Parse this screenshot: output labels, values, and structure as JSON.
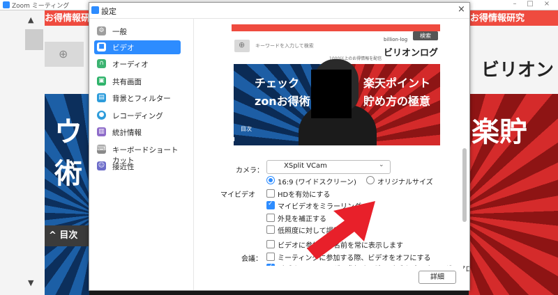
{
  "window": {
    "title": "Zoom ミーティング"
  },
  "background": {
    "banner_left": "お得情報研究",
    "banner_right": "お得情報研究",
    "text_right": "ビリオン",
    "jp_left": "ウ術",
    "jp_right": "楽貯",
    "tag_left": "^ 目次"
  },
  "dialog": {
    "title": "設定",
    "close": "×",
    "nav": [
      {
        "label": "一般",
        "icon": "gear-icon",
        "color": "#9e9e9e"
      },
      {
        "label": "ビデオ",
        "icon": "video-camera-icon",
        "color": "#2d8cff",
        "active": true
      },
      {
        "label": "オーディオ",
        "icon": "headphones-icon",
        "color": "#3cb371"
      },
      {
        "label": "共有画面",
        "icon": "share-screen-icon",
        "color": "#2fb36b"
      },
      {
        "label": "背景とフィルター",
        "icon": "background-icon",
        "color": "#2d9cdb"
      },
      {
        "label": "レコーディング",
        "icon": "record-icon",
        "color": "#2d9cdb"
      },
      {
        "label": "統計情報",
        "icon": "stats-icon",
        "color": "#8e6cc9"
      },
      {
        "label": "キーボードショートカット",
        "icon": "keyboard-icon",
        "color": "#8a8a8a"
      },
      {
        "label": "接近性",
        "icon": "accessibility-icon",
        "color": "#6c6cc9"
      }
    ],
    "preview": {
      "mirror_text": "キーワードを入力して検索",
      "logo_small": "billion-log",
      "logo_big": "ビリオンログ",
      "sub_text": "1000以上のお得情報を配信",
      "button": "検索",
      "jp1": "楽天ポイント",
      "jp2": "貯め方の極意",
      "jp3": "チェック",
      "jp4": "zonお得術",
      "tag": "目次"
    },
    "camera_label": "カメラ：",
    "camera_value": "XSplit VCam",
    "ratio_options": [
      {
        "label": "16:9 (ワイドスクリーン)",
        "selected": true
      },
      {
        "label": "オリジナルサイズ",
        "selected": false
      }
    ],
    "myvideo_label": "マイビデオ",
    "myvideo_options": [
      {
        "label": "HDを有効にする",
        "checked": false
      },
      {
        "label": "マイビデオをミラーリング",
        "checked": true
      },
      {
        "label": "外見を補正する",
        "checked": false
      },
      {
        "label": "低照度に対して調整",
        "checked": false
      }
    ],
    "meeting_label": "会議：",
    "meeting_options": [
      {
        "label": "ビデオに参加者の名前を常に表示します",
        "checked": false
      },
      {
        "label": "ミーティングに参加する際、ビデオをオフにする",
        "checked": false
      },
      {
        "label": "ビデオミーティングに参加する時にビデオプレビューダイアログを表示します",
        "checked": true
      }
    ],
    "details_button": "詳細"
  },
  "accent_color": "#2d8cff",
  "annotation_color": "#e8202a"
}
